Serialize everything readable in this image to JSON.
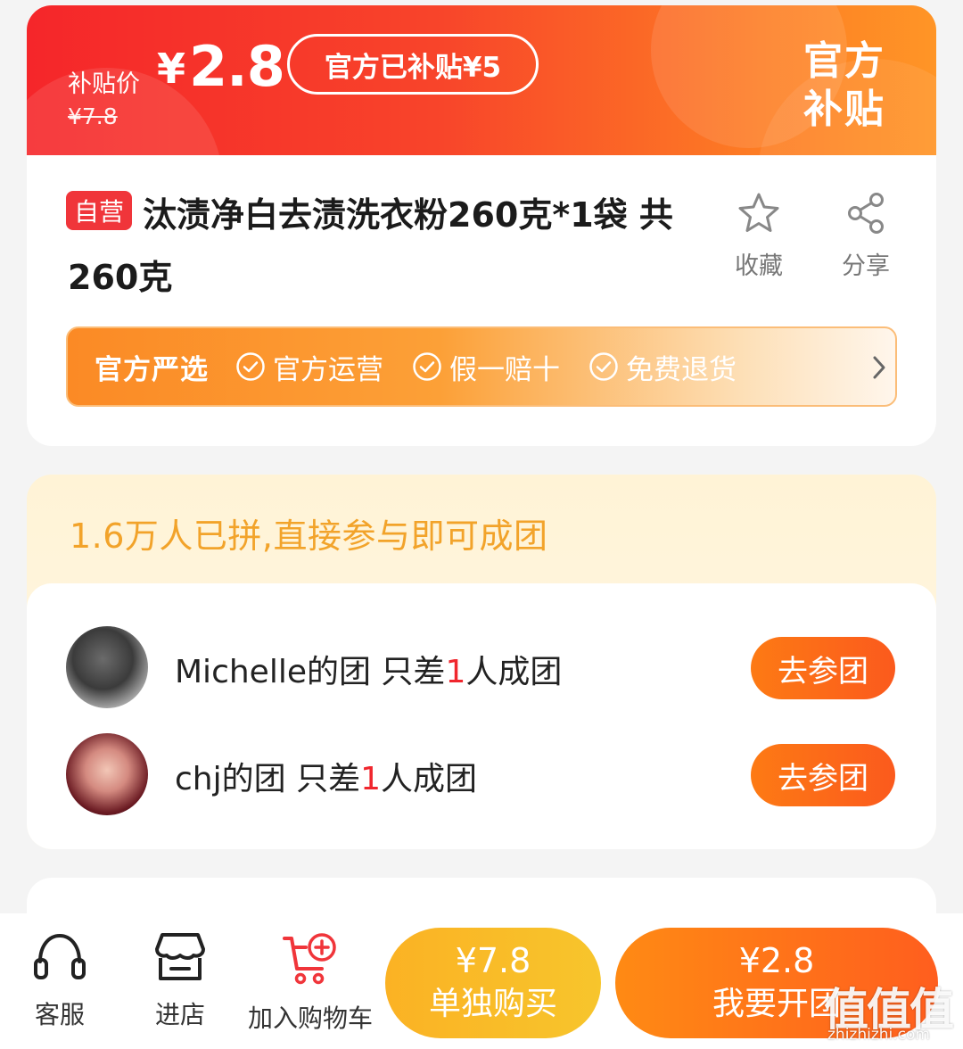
{
  "subsidy_banner": {
    "label": "补贴价",
    "currency": "¥",
    "price": "2.8",
    "original_price": "¥7.8",
    "pill_text": "官方已补贴¥5",
    "stamp_line1": "官方",
    "stamp_line2": "补贴",
    "gradient_start": "#f5262a",
    "gradient_end": "#ff9526"
  },
  "product": {
    "badge": "自营",
    "title": "汰渍净白去渍洗衣粉260克*1袋 共260克",
    "actions": {
      "favorite_label": "收藏",
      "share_label": "分享"
    }
  },
  "guarantee": {
    "title": "官方严选",
    "items": [
      "官方运营",
      "假一赔十",
      "免费退货"
    ]
  },
  "group_buy": {
    "headline": "1.6万人已拼,直接参与即可成团",
    "rows": [
      {
        "owner": "Michelle的团",
        "prefix": " 只差",
        "count": "1",
        "suffix": "人成团",
        "button": "去参团"
      },
      {
        "owner": "chj的团",
        "prefix": " 只差",
        "count": "1",
        "suffix": "人成团",
        "button": "去参团"
      }
    ],
    "highlight_color": "#f0262d"
  },
  "bottom_bar": {
    "nav": {
      "service_label": "客服",
      "store_label": "进店",
      "cart_label": "加入购物车"
    },
    "single_buy": {
      "price": "¥7.8",
      "label": "单独购买"
    },
    "group_buy": {
      "price": "¥2.8",
      "label": "我要开团"
    }
  },
  "watermark": {
    "logo": "值值值",
    "url": "zhizhizhi.com"
  },
  "icons": [
    "star-icon",
    "share-icon",
    "check-circle-icon",
    "chevron-right-icon",
    "headset-icon",
    "store-icon",
    "cart-add-icon"
  ],
  "accent_color": "#fd7a14"
}
